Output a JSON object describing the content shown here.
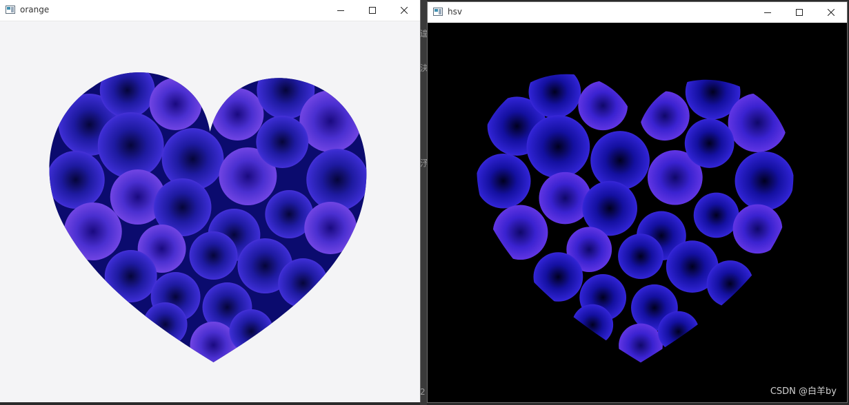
{
  "windows": {
    "left": {
      "title": "orange"
    },
    "right": {
      "title": "hsv"
    }
  },
  "background_glyphs": [
    "遑",
    "決",
    "汿",
    "2"
  ],
  "watermark": "CSDN @白羊by",
  "colors": {
    "rose_dark": "#0a0a70",
    "rose_mid": "#2a1fb0",
    "rose_light": "#6a3fe0",
    "left_bg": "#f4f4f6",
    "right_bg": "#000000"
  },
  "icons": {
    "app": "opencv-window-icon",
    "minimize": "minimize-icon",
    "maximize": "maximize-icon",
    "close": "close-icon"
  }
}
